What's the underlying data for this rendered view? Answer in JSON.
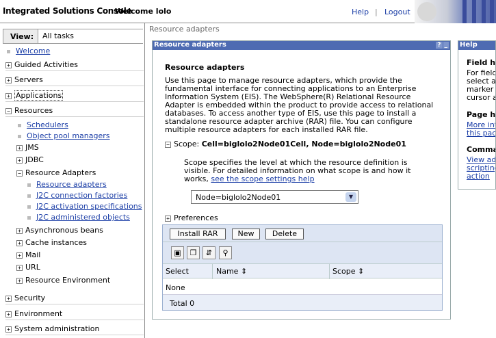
{
  "banner": {
    "title": "Integrated Solutions Console",
    "welcome": "Welcome lolo",
    "help": "Help",
    "separator": "|",
    "logout": "Logout"
  },
  "nav": {
    "view_label": "View:",
    "view_value": "All tasks",
    "welcome": "Welcome",
    "guided": "Guided Activities",
    "servers": "Servers",
    "applications": "Applications",
    "resources": "Resources",
    "schedulers": "Schedulers",
    "object_pool": "Object pool managers",
    "jms": "JMS",
    "jdbc": "JDBC",
    "resource_adapters": "Resource Adapters",
    "ra_link": "Resource adapters",
    "j2c_cf": "J2C connection factories",
    "j2c_as": "J2C activation specifications",
    "j2c_ao": "J2C administered objects",
    "async": "Asynchronous beans",
    "cache": "Cache instances",
    "mail": "Mail",
    "url": "URL",
    "res_env": "Resource Environment",
    "security": "Security",
    "environment": "Environment",
    "sysadmin": "System administration",
    "expand_plus": "+",
    "collapse_minus": "−"
  },
  "content": {
    "title": "Resource adapters",
    "panel_title": "Resource adapters",
    "panel_help": "?",
    "panel_min": "_",
    "heading": "Resource adapters",
    "description": "Use this page to manage resource adapters, which provide the fundamental interface for connecting applications to an Enterprise Information System (EIS). The WebSphere(R) Relational Resource Adapter is embedded within the product to provide access to relational databases. To access another type of EIS, use this page to install a standalone resource adapter archive (RAR) file. You can configure multiple resource adapters for each installed RAR file.",
    "scope_prefix": "Scope: ",
    "scope_value": "Cell=biglolo2Node01Cell, Node=biglolo2Node01",
    "scope_desc_1": "Scope specifies the level at which the resource definition is visible. For detailed information on what scope is and how it works, ",
    "scope_link": "see the scope settings help",
    "scope_select": "Node=biglolo2Node01",
    "preferences": "Preferences",
    "buttons": {
      "install": "Install RAR",
      "new": "New",
      "delete": "Delete"
    },
    "table": {
      "col_select": "Select",
      "col_name": "Name",
      "col_scope": "Scope",
      "sort_glyph": "⇕",
      "none": "None",
      "total": "Total 0"
    }
  },
  "help_panel": {
    "title": "Help",
    "field_help": "Field he",
    "fh1": "For field",
    "fh2": "select a",
    "fh3": "marker",
    "fh4": "cursor a",
    "page_help": "Page he",
    "ph1": "More int",
    "ph2": "this pac",
    "command": "Comma",
    "c1": "View ad",
    "c2": "scripting",
    "c3": "action"
  }
}
